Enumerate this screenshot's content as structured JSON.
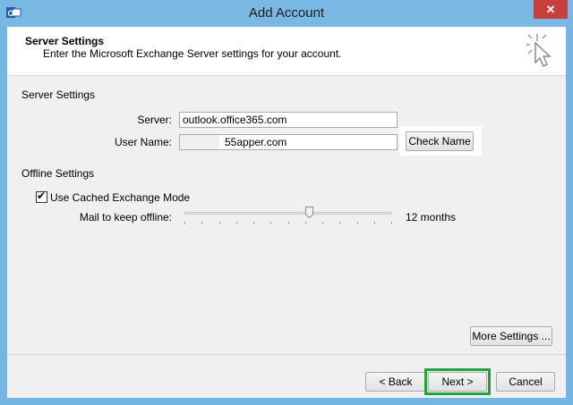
{
  "window": {
    "title": "Add Account",
    "close_label": "✕"
  },
  "header": {
    "title": "Server Settings",
    "subtitle": "Enter the Microsoft Exchange Server settings for your account."
  },
  "server_settings": {
    "group_label": "Server Settings",
    "server_label": "Server:",
    "server_value": "outlook.office365.com",
    "username_label": "User Name:",
    "username_value": "55apper.com",
    "check_name_label": "Check Name"
  },
  "offline_settings": {
    "group_label": "Offline Settings",
    "cached_mode_label": "Use Cached Exchange Mode",
    "cached_mode_checked": true,
    "mail_offline_label": "Mail to keep offline:",
    "mail_offline_value": "12 months",
    "slider_fraction": 0.6
  },
  "buttons": {
    "more_settings": "More Settings ...",
    "back": "< Back",
    "next": "Next >",
    "cancel": "Cancel"
  },
  "colors": {
    "titlebar": "#79b8e3",
    "close": "#c7413a",
    "next_highlight": "#21a33b"
  }
}
